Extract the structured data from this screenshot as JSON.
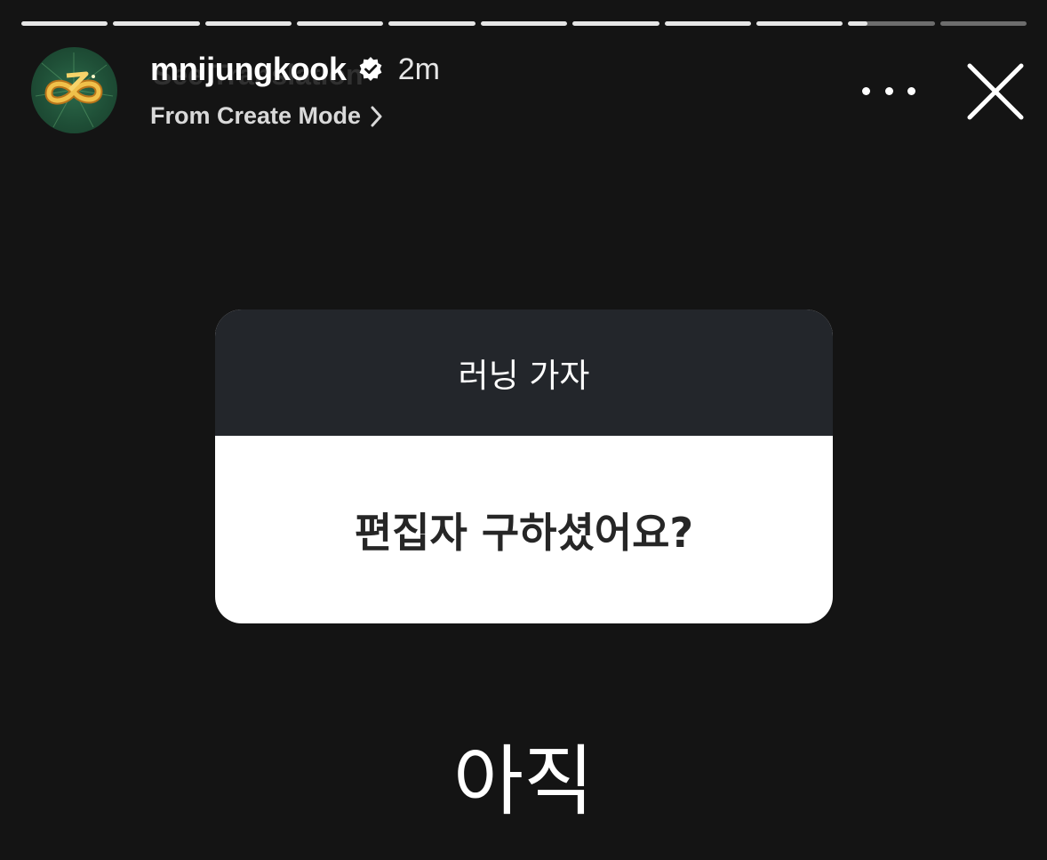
{
  "story": {
    "progress_segments": [
      1,
      1,
      1,
      1,
      1,
      1,
      1,
      1,
      1,
      0.22,
      0
    ]
  },
  "header": {
    "avatar_icon": "golden-infinity-logo",
    "username": "mnijungkook",
    "verified_icon": "verified-badge-icon",
    "time": "2m",
    "ghost_text": "See Translation",
    "subtitle": "From Create Mode",
    "more_icon": "more-horizontal-icon",
    "close_icon": "close-icon"
  },
  "question_sticker": {
    "prompt": "러닝 가자",
    "question": "편집자 구하셨어요?"
  },
  "answer": {
    "text": "아직"
  },
  "colors": {
    "background": "#141414",
    "card_header": "#23262b",
    "card_body": "#ffffff",
    "avatar_bg": "#1f4f37",
    "logo_gold": "#e7a72b"
  }
}
